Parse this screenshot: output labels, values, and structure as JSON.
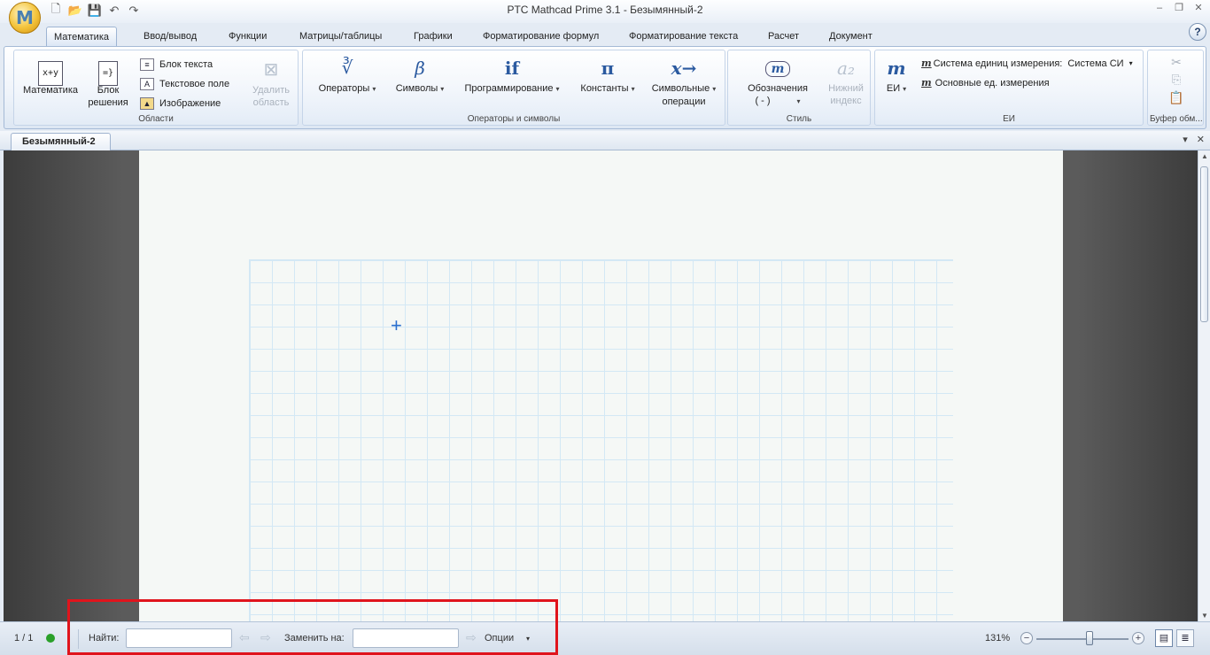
{
  "window": {
    "title": "PTC Mathcad Prime 3.1 - Безымянный-2",
    "app_icon_letter": "M",
    "controls": {
      "minimize": "–",
      "restore": "❐",
      "close": "✕"
    }
  },
  "quick_access": {
    "icons": [
      "new-document-icon",
      "open-folder-icon",
      "save-icon",
      "undo-icon",
      "redo-icon"
    ]
  },
  "ribbon": {
    "tabs": [
      "Математика",
      "Ввод/вывод",
      "Функции",
      "Матрицы/таблицы",
      "Графики",
      "Форматирование формул",
      "Форматирование текста",
      "Расчет",
      "Документ"
    ],
    "active_tab": "Математика",
    "help_label": "?",
    "groups": {
      "regions": {
        "label": "Области",
        "math_label": "Математика",
        "math_icon_text": "x+y",
        "solve_label_1": "Блок",
        "solve_label_2": "решения",
        "solve_icon_text": "=}",
        "text_block_label": "Блок текста",
        "text_field_label": "Текстовое поле",
        "text_field_icon_text": "A",
        "image_label": "Изображение",
        "delete_label_1": "Удалить",
        "delete_label_2": "область"
      },
      "operators": {
        "label": "Операторы и символы",
        "operators_label": "Операторы",
        "operators_icon": "∛",
        "symbols_label": "Символы",
        "symbols_icon": "β",
        "programming_label": "Программирование",
        "programming_icon": "if",
        "constants_label": "Константы",
        "constants_icon": "π",
        "symbolic_label_1": "Символьные",
        "symbolic_label_2": "операции",
        "symbolic_icon": "x→"
      },
      "style": {
        "label": "Стиль",
        "labels_label_1": "Обозначения",
        "labels_label_2": "( - )",
        "subscript_label_1": "Нижний",
        "subscript_label_2": "индекс",
        "subscript_icon": "a₂"
      },
      "units": {
        "label": "ЕИ",
        "units_label": "ЕИ",
        "units_icon": "m",
        "system_label": "Система единиц измерения:",
        "system_value": "Система СИ",
        "base_units_label": "Основные ед. измерения"
      },
      "clipboard": {
        "label": "Буфер обм..."
      }
    }
  },
  "document": {
    "tab_label": "Безымянный-2",
    "cursor_glyph": "+"
  },
  "statusbar": {
    "page_indicator": "1 / 1",
    "find_label": "Найти:",
    "find_value": "",
    "replace_label": "Заменить на:",
    "replace_value": "",
    "options_label": "Опции",
    "zoom_level": "131%",
    "zoom_fraction": 0.58,
    "status_color": "#2aa02a"
  },
  "colors": {
    "highlight": "#e0141c",
    "accent": "#2b5aa0",
    "grid_line": "#d3e8f5"
  }
}
